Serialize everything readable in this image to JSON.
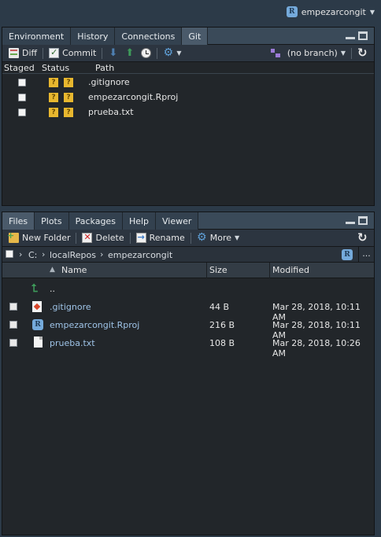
{
  "project": {
    "name": "empezarcongit"
  },
  "top_pane": {
    "tabs": [
      {
        "label": "Environment",
        "active": false
      },
      {
        "label": "History",
        "active": false
      },
      {
        "label": "Connections",
        "active": false
      },
      {
        "label": "Git",
        "active": true
      }
    ],
    "toolbar": {
      "diff": "Diff",
      "commit": "Commit",
      "branch": "(no branch)"
    },
    "columns": {
      "staged": "Staged",
      "status": "Status",
      "path": "Path"
    },
    "files": [
      {
        "status": [
          "?",
          "?"
        ],
        "path": ".gitignore"
      },
      {
        "status": [
          "?",
          "?"
        ],
        "path": "empezarcongit.Rproj"
      },
      {
        "status": [
          "?",
          "?"
        ],
        "path": "prueba.txt"
      }
    ]
  },
  "bottom_pane": {
    "tabs": [
      {
        "label": "Files",
        "active": true
      },
      {
        "label": "Plots",
        "active": false
      },
      {
        "label": "Packages",
        "active": false
      },
      {
        "label": "Help",
        "active": false
      },
      {
        "label": "Viewer",
        "active": false
      }
    ],
    "toolbar": {
      "new_folder": "New Folder",
      "delete": "Delete",
      "rename": "Rename",
      "more": "More"
    },
    "breadcrumb": [
      "C:",
      "localRepos",
      "empezarcongit"
    ],
    "more_dots": "...",
    "columns": {
      "name": "Name",
      "size": "Size",
      "modified": "Modified"
    },
    "parent_label": "..",
    "files": [
      {
        "name": ".gitignore",
        "size": "44 B",
        "modified": "Mar 28, 2018, 10:11 AM"
      },
      {
        "name": "empezarcongit.Rproj",
        "size": "216 B",
        "modified": "Mar 28, 2018, 10:11 AM"
      },
      {
        "name": "prueba.txt",
        "size": "108 B",
        "modified": "Mar 28, 2018, 10:26 AM"
      }
    ]
  },
  "colors": {
    "accent_blue": "#75aadb",
    "status_yellow": "#e8b72f",
    "pane_bg": "#22262a"
  },
  "icons": [
    "r-project-icon",
    "diff-icon",
    "commit-icon",
    "pull-icon",
    "push-icon",
    "history-icon",
    "gear-icon",
    "branch-icon",
    "refresh-icon",
    "new-folder-icon",
    "delete-icon",
    "rename-icon",
    "up-arrow-icon",
    "git-file-icon",
    "rproj-file-icon",
    "text-file-icon"
  ]
}
